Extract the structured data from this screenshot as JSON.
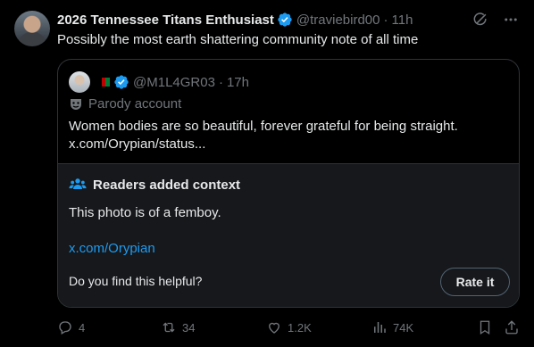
{
  "post": {
    "author_name": "2026 Tennessee Titans Enthusiast",
    "handle": "@traviebird00",
    "separator": "·",
    "time": "11h",
    "text": "Possibly the most earth shattering community note of all time"
  },
  "quote": {
    "handle": "@M1L4GR03",
    "separator": "·",
    "time": "17h",
    "parody_label": "Parody account",
    "text": "Women bodies are so beautiful, forever grateful for being straight. x.com/Orypian/status..."
  },
  "community_note": {
    "title": "Readers added context",
    "body": "This photo is of a femboy.",
    "link": "x.com/Orypian",
    "question": "Do you find this helpful?",
    "rate_button": "Rate it"
  },
  "actions": {
    "replies": "4",
    "reposts": "34",
    "likes": "1.2K",
    "views": "74K"
  },
  "colors": {
    "background": "#000000",
    "text": "#e7e9ea",
    "secondary": "#71767b",
    "accent": "#1d9bf0",
    "border": "#2f3336",
    "note_bg": "#16181c"
  },
  "icons": [
    "verified-badge-icon",
    "grok-icon",
    "more-icon",
    "parody-mask-icon",
    "readers-icon",
    "reply-icon",
    "repost-icon",
    "like-icon",
    "views-icon",
    "bookmark-icon",
    "share-icon"
  ]
}
